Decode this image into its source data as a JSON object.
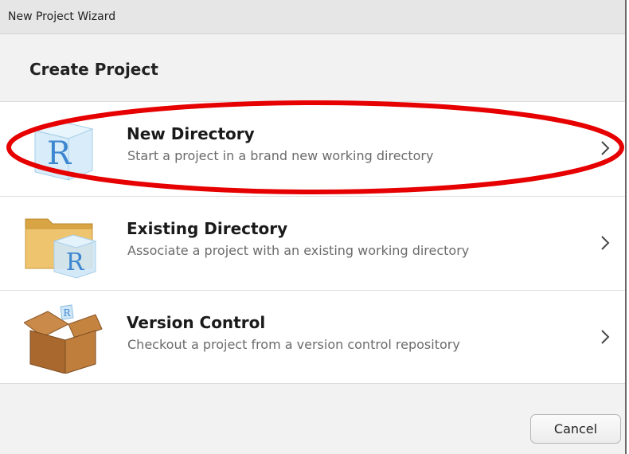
{
  "window": {
    "title": "New Project Wizard"
  },
  "page": {
    "heading": "Create Project"
  },
  "options": [
    {
      "id": "new-directory",
      "title": "New Directory",
      "description": "Start a project in a brand new working directory",
      "icon": "r-cube-icon"
    },
    {
      "id": "existing-directory",
      "title": "Existing Directory",
      "description": "Associate a project with an existing working directory",
      "icon": "folder-r-cube-icon"
    },
    {
      "id": "version-control",
      "title": "Version Control",
      "description": "Checkout a project from a version control repository",
      "icon": "cardboard-box-icon"
    }
  ],
  "footer": {
    "cancel_label": "Cancel"
  },
  "annotation": {
    "highlight_color": "#e60000",
    "highlighted_option": "new-directory"
  },
  "colors": {
    "r_letter": "#3d86d0",
    "cube_fill": "#cfe7f7",
    "folder": "#e3b559",
    "box": "#b5763a"
  }
}
